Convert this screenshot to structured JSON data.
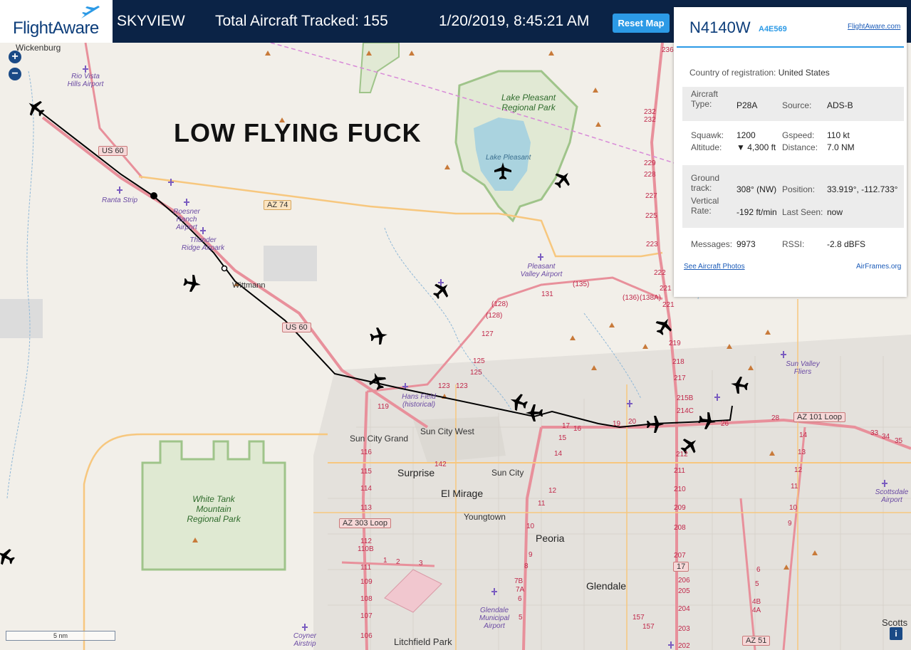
{
  "header": {
    "logo": "FlightAware",
    "app_name": "SKYVIEW",
    "tracked": "Total Aircraft Tracked: 155",
    "datetime": "1/20/2019, 8:45:21 AM",
    "reset_button": "Reset Map"
  },
  "map": {
    "overlay_text": "LOW FLYING FUCK",
    "zoom_in": "+",
    "zoom_out": "−",
    "scale": "5 nm",
    "info": "i",
    "places": {
      "wickenburg": "Wickenburg",
      "wittmann": "Wittmann",
      "sun_city_grand": "Sun City Grand",
      "sun_city_west": "Sun City West",
      "surprise": "Surprise",
      "sun_city": "Sun City",
      "el_mirage": "El Mirage",
      "youngtown": "Youngtown",
      "peoria": "Peoria",
      "glendale": "Glendale",
      "litchfield_park": "Litchfield Park",
      "scottsdale": "Scotts"
    },
    "parks": {
      "lake_pleasant_park": "Lake Pleasant Regional Park",
      "lake_pleasant": "Lake Pleasant",
      "white_tank": "White Tank Mountain Regional Park"
    },
    "airports": {
      "rio_vista": "Rio Vista Hills Airport",
      "ranta": "Ranta Strip",
      "roesner": "Roesner Ranch Airport",
      "thunder_ridge": "Thunder Ridge Airpark",
      "pleasant_valley": "Pleasant Valley Airport",
      "hans_field": "Hans Field (historical)",
      "sun_valley": "Sun Valley Fliers",
      "glendale_muni": "Glendale Municipal Airport",
      "coyner": "Coyner Airstrip",
      "scottsdale_airport": "Scottsdale Airport"
    },
    "shields": {
      "us60a": "US 60",
      "us60b": "US 60",
      "az74": "AZ 74",
      "az303": "AZ 303 Loop",
      "az101": "AZ 101 Loop",
      "i17": "17",
      "az51": "AZ 51"
    },
    "routes": {
      "r236": "236",
      "r232a": "232",
      "r232b": "232",
      "r229": "229",
      "r228": "228",
      "r227": "227",
      "r225": "225",
      "r223": "223",
      "r222": "222",
      "r221": "221",
      "r221b": "221",
      "r219": "219",
      "r218": "218",
      "r217": "217",
      "r215b": "215B",
      "r214c": "214C",
      "r212": "212",
      "r211": "211",
      "r210": "210",
      "r209": "209",
      "r208": "208",
      "r207": "207",
      "r206": "206",
      "r205": "205",
      "r204": "204",
      "r203": "203",
      "r202": "202",
      "r201": "201",
      "r135": "(135)",
      "r136": "(136)",
      "r138a": "(138A)",
      "r131": "131",
      "r128": "(128)",
      "r128b": "(128)",
      "r127": "127",
      "r125": "125",
      "r125b": "125",
      "r123": "123",
      "r123b": "123",
      "r119": "119",
      "r116": "116",
      "r115": "115",
      "r114": "114",
      "r113": "113",
      "r112": "112",
      "r110b": "110B",
      "r111": "111",
      "r109": "109",
      "r108": "108",
      "r107": "107",
      "r106": "106",
      "r142": "142",
      "r17": "17",
      "r16": "16",
      "r15": "15",
      "r14": "14",
      "r12": "12",
      "r11": "11",
      "r10": "10",
      "r9": "9",
      "r8": "8",
      "r7b": "7B",
      "r7a": "7A",
      "r6": "6",
      "r5": "5",
      "r19": "19",
      "r20": "20",
      "r23": "23",
      "r26": "26",
      "r28": "28",
      "r33": "33",
      "r34": "34",
      "r35": "35",
      "rr14": "14",
      "rr13": "13",
      "rr12": "12",
      "rr11": "11",
      "rr10": "10",
      "rr9": "9",
      "rr6": "6",
      "rr5": "5",
      "rr4b": "4B",
      "rr4a": "4A",
      "rr1": "1",
      "rr2": "2",
      "rr3": "3",
      "rr157": "157",
      "rr157b": "157"
    }
  },
  "panel": {
    "registration": "N4140W",
    "hex": "A4E569",
    "fa_link": "FlightAware.com",
    "country_label": "Country of registration:",
    "country_value": "United States",
    "aircraft_type_label": "Aircraft Type:",
    "aircraft_type_value": "P28A",
    "source_label": "Source:",
    "source_value": "ADS-B",
    "squawk_label": "Squawk:",
    "squawk_value": "1200",
    "gspeed_label": "Gspeed:",
    "gspeed_value": "110 kt",
    "altitude_label": "Altitude:",
    "altitude_value": "▼ 4,300 ft",
    "distance_label": "Distance:",
    "distance_value": "7.0 NM",
    "ground_track_label": "Ground track:",
    "ground_track_value": "308° (NW)",
    "position_label": "Position:",
    "position_value": "33.919°, -112.733°",
    "vertical_rate_label": "Vertical Rate:",
    "vertical_rate_value": "-192 ft/min",
    "last_seen_label": "Last Seen:",
    "last_seen_value": "now",
    "messages_label": "Messages:",
    "messages_value": "9973",
    "rssi_label": "RSSI:",
    "rssi_value": "-2.8 dBFS",
    "photos_link": "See Aircraft Photos",
    "airframes_link": "AirFrames.org"
  },
  "colors": {
    "header_bg": "#0b2346",
    "accent": "#2c9ae6",
    "map_bg": "#f2efe9",
    "park_green": "#c8e0b4",
    "water": "#aad3df",
    "highway_red": "#e8909b",
    "road_orange": "#f7c77e",
    "track": "#000000"
  },
  "icons": [
    "plane-icon",
    "airport-icon",
    "peak-icon"
  ]
}
